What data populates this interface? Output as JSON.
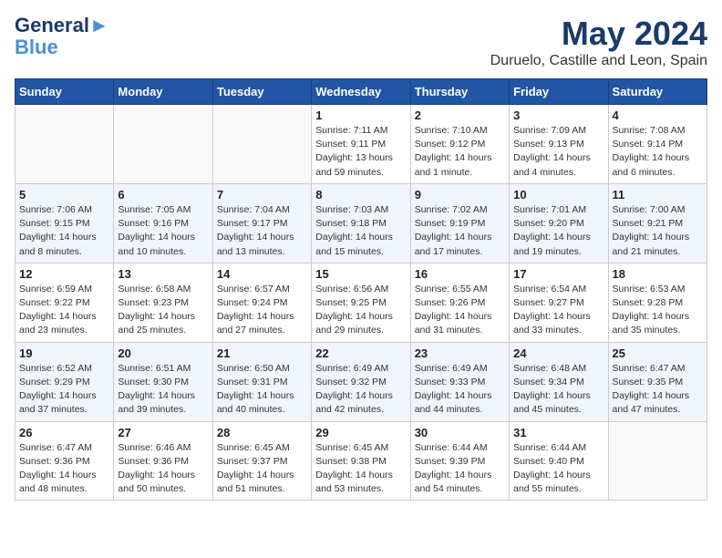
{
  "header": {
    "logo_line1": "General",
    "logo_line2": "Blue",
    "main_title": "May 2024",
    "subtitle": "Duruelo, Castille and Leon, Spain"
  },
  "weekdays": [
    "Sunday",
    "Monday",
    "Tuesday",
    "Wednesday",
    "Thursday",
    "Friday",
    "Saturday"
  ],
  "weeks": [
    [
      {
        "day": "",
        "info": ""
      },
      {
        "day": "",
        "info": ""
      },
      {
        "day": "",
        "info": ""
      },
      {
        "day": "1",
        "info": "Sunrise: 7:11 AM\nSunset: 9:11 PM\nDaylight: 13 hours\nand 59 minutes."
      },
      {
        "day": "2",
        "info": "Sunrise: 7:10 AM\nSunset: 9:12 PM\nDaylight: 14 hours\nand 1 minute."
      },
      {
        "day": "3",
        "info": "Sunrise: 7:09 AM\nSunset: 9:13 PM\nDaylight: 14 hours\nand 4 minutes."
      },
      {
        "day": "4",
        "info": "Sunrise: 7:08 AM\nSunset: 9:14 PM\nDaylight: 14 hours\nand 6 minutes."
      }
    ],
    [
      {
        "day": "5",
        "info": "Sunrise: 7:06 AM\nSunset: 9:15 PM\nDaylight: 14 hours\nand 8 minutes."
      },
      {
        "day": "6",
        "info": "Sunrise: 7:05 AM\nSunset: 9:16 PM\nDaylight: 14 hours\nand 10 minutes."
      },
      {
        "day": "7",
        "info": "Sunrise: 7:04 AM\nSunset: 9:17 PM\nDaylight: 14 hours\nand 13 minutes."
      },
      {
        "day": "8",
        "info": "Sunrise: 7:03 AM\nSunset: 9:18 PM\nDaylight: 14 hours\nand 15 minutes."
      },
      {
        "day": "9",
        "info": "Sunrise: 7:02 AM\nSunset: 9:19 PM\nDaylight: 14 hours\nand 17 minutes."
      },
      {
        "day": "10",
        "info": "Sunrise: 7:01 AM\nSunset: 9:20 PM\nDaylight: 14 hours\nand 19 minutes."
      },
      {
        "day": "11",
        "info": "Sunrise: 7:00 AM\nSunset: 9:21 PM\nDaylight: 14 hours\nand 21 minutes."
      }
    ],
    [
      {
        "day": "12",
        "info": "Sunrise: 6:59 AM\nSunset: 9:22 PM\nDaylight: 14 hours\nand 23 minutes."
      },
      {
        "day": "13",
        "info": "Sunrise: 6:58 AM\nSunset: 9:23 PM\nDaylight: 14 hours\nand 25 minutes."
      },
      {
        "day": "14",
        "info": "Sunrise: 6:57 AM\nSunset: 9:24 PM\nDaylight: 14 hours\nand 27 minutes."
      },
      {
        "day": "15",
        "info": "Sunrise: 6:56 AM\nSunset: 9:25 PM\nDaylight: 14 hours\nand 29 minutes."
      },
      {
        "day": "16",
        "info": "Sunrise: 6:55 AM\nSunset: 9:26 PM\nDaylight: 14 hours\nand 31 minutes."
      },
      {
        "day": "17",
        "info": "Sunrise: 6:54 AM\nSunset: 9:27 PM\nDaylight: 14 hours\nand 33 minutes."
      },
      {
        "day": "18",
        "info": "Sunrise: 6:53 AM\nSunset: 9:28 PM\nDaylight: 14 hours\nand 35 minutes."
      }
    ],
    [
      {
        "day": "19",
        "info": "Sunrise: 6:52 AM\nSunset: 9:29 PM\nDaylight: 14 hours\nand 37 minutes."
      },
      {
        "day": "20",
        "info": "Sunrise: 6:51 AM\nSunset: 9:30 PM\nDaylight: 14 hours\nand 39 minutes."
      },
      {
        "day": "21",
        "info": "Sunrise: 6:50 AM\nSunset: 9:31 PM\nDaylight: 14 hours\nand 40 minutes."
      },
      {
        "day": "22",
        "info": "Sunrise: 6:49 AM\nSunset: 9:32 PM\nDaylight: 14 hours\nand 42 minutes."
      },
      {
        "day": "23",
        "info": "Sunrise: 6:49 AM\nSunset: 9:33 PM\nDaylight: 14 hours\nand 44 minutes."
      },
      {
        "day": "24",
        "info": "Sunrise: 6:48 AM\nSunset: 9:34 PM\nDaylight: 14 hours\nand 45 minutes."
      },
      {
        "day": "25",
        "info": "Sunrise: 6:47 AM\nSunset: 9:35 PM\nDaylight: 14 hours\nand 47 minutes."
      }
    ],
    [
      {
        "day": "26",
        "info": "Sunrise: 6:47 AM\nSunset: 9:36 PM\nDaylight: 14 hours\nand 48 minutes."
      },
      {
        "day": "27",
        "info": "Sunrise: 6:46 AM\nSunset: 9:36 PM\nDaylight: 14 hours\nand 50 minutes."
      },
      {
        "day": "28",
        "info": "Sunrise: 6:45 AM\nSunset: 9:37 PM\nDaylight: 14 hours\nand 51 minutes."
      },
      {
        "day": "29",
        "info": "Sunrise: 6:45 AM\nSunset: 9:38 PM\nDaylight: 14 hours\nand 53 minutes."
      },
      {
        "day": "30",
        "info": "Sunrise: 6:44 AM\nSunset: 9:39 PM\nDaylight: 14 hours\nand 54 minutes."
      },
      {
        "day": "31",
        "info": "Sunrise: 6:44 AM\nSunset: 9:40 PM\nDaylight: 14 hours\nand 55 minutes."
      },
      {
        "day": "",
        "info": ""
      }
    ]
  ]
}
